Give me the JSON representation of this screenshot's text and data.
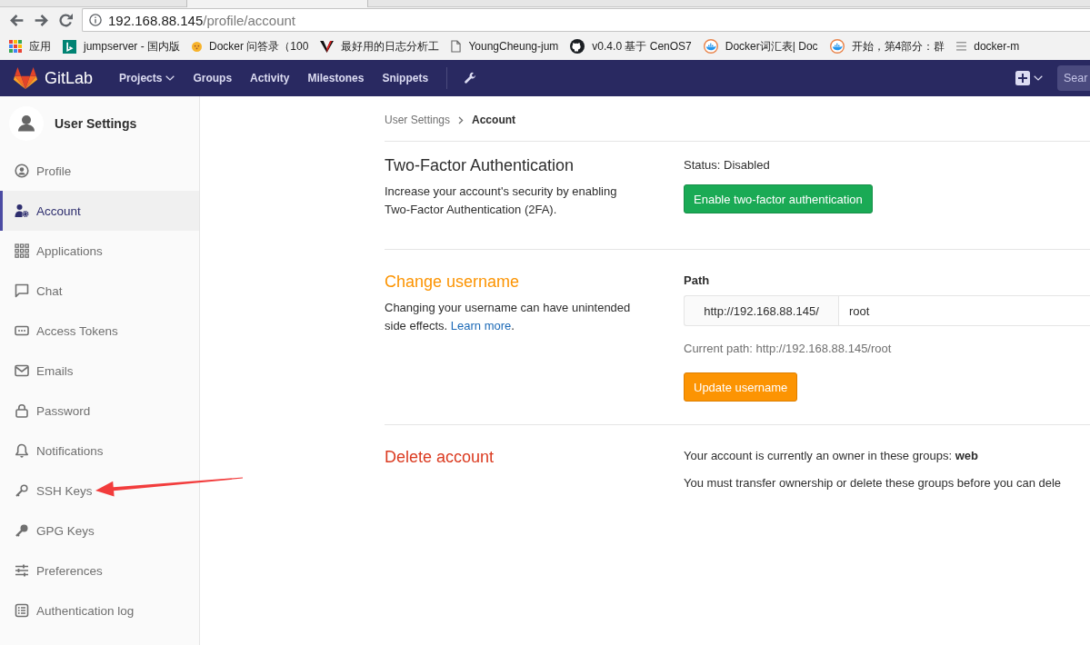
{
  "browser": {
    "address_bar": {
      "host": "192.168.88.145",
      "path": "/profile/account"
    },
    "bookmarks": [
      {
        "kind": "apps",
        "label": "应用"
      },
      {
        "kind": "square_logo",
        "label": "jumpserver - 国内版"
      },
      {
        "kind": "dot",
        "label": "Docker 问答录（100"
      },
      {
        "kind": "v_logo",
        "label": "最好用的日志分析工"
      },
      {
        "kind": "page",
        "label": "YoungCheung-jum"
      },
      {
        "kind": "cat_logo",
        "label": "v0.4.0 基于 CenOS7"
      },
      {
        "kind": "whale_logo",
        "label": "Docker词汇表| Doc"
      },
      {
        "kind": "whale_logo",
        "label": "开始，第4部分：群"
      },
      {
        "kind": "list",
        "label": "docker-m"
      }
    ]
  },
  "navbar": {
    "brand": "GitLab",
    "links": [
      {
        "label": "Projects",
        "dropdown": true
      },
      {
        "label": "Groups",
        "dropdown": false
      },
      {
        "label": "Activity",
        "dropdown": false
      },
      {
        "label": "Milestones",
        "dropdown": false
      },
      {
        "label": "Snippets",
        "dropdown": false
      }
    ],
    "search": {
      "placeholder": "Sear"
    }
  },
  "sidebar": {
    "title": "User Settings",
    "items": [
      {
        "kind": "profile",
        "label": "Profile",
        "selected": false,
        "arrow_marked": false
      },
      {
        "kind": "account",
        "label": "Account",
        "selected": true,
        "arrow_marked": false
      },
      {
        "kind": "applications",
        "label": "Applications",
        "selected": false,
        "arrow_marked": false
      },
      {
        "kind": "chat",
        "label": "Chat",
        "selected": false,
        "arrow_marked": false
      },
      {
        "kind": "tokens",
        "label": "Access Tokens",
        "selected": false,
        "arrow_marked": false
      },
      {
        "kind": "emails",
        "label": "Emails",
        "selected": false,
        "arrow_marked": false
      },
      {
        "kind": "password",
        "label": "Password",
        "selected": false,
        "arrow_marked": false
      },
      {
        "kind": "notifications",
        "label": "Notifications",
        "selected": false,
        "arrow_marked": false
      },
      {
        "kind": "ssh_keys",
        "label": "SSH Keys",
        "selected": false,
        "arrow_marked": true
      },
      {
        "kind": "gpg_keys",
        "label": "GPG Keys",
        "selected": false,
        "arrow_marked": false
      },
      {
        "kind": "preferences",
        "label": "Preferences",
        "selected": false,
        "arrow_marked": false
      },
      {
        "kind": "auth_log",
        "label": "Authentication log",
        "selected": false,
        "arrow_marked": false
      }
    ]
  },
  "breadcrumb": [
    {
      "label": "User Settings",
      "current": false
    },
    {
      "label": "Account",
      "current": true
    }
  ],
  "sections": [
    {
      "kind": "status",
      "color": "#2e2e2e",
      "title": "Two-Factor Authentication",
      "description": "Increase your account's security by enabling Two-Factor Authentication (2FA).",
      "status": "Status: Disabled",
      "button": {
        "kind": "success",
        "label": "Enable two-factor authentication"
      }
    },
    {
      "kind": "path_form",
      "color": "#fc9403",
      "title": "Change username",
      "description": "Changing your username can have unintended side effects.",
      "link": "Learn more",
      "link_suffix": ".",
      "field_label": "Path",
      "prefix": "http://192.168.88.145/",
      "value": "root",
      "hint": "Current path: http://192.168.88.145/root",
      "button": {
        "kind": "warning",
        "label": "Update username"
      }
    },
    {
      "kind": "notice",
      "color": "#db3b21",
      "title": "Delete account",
      "notes": [
        "Your account is currently an owner in these groups: **web**",
        "You must transfer ownership or delete these groups before you can dele"
      ]
    }
  ]
}
